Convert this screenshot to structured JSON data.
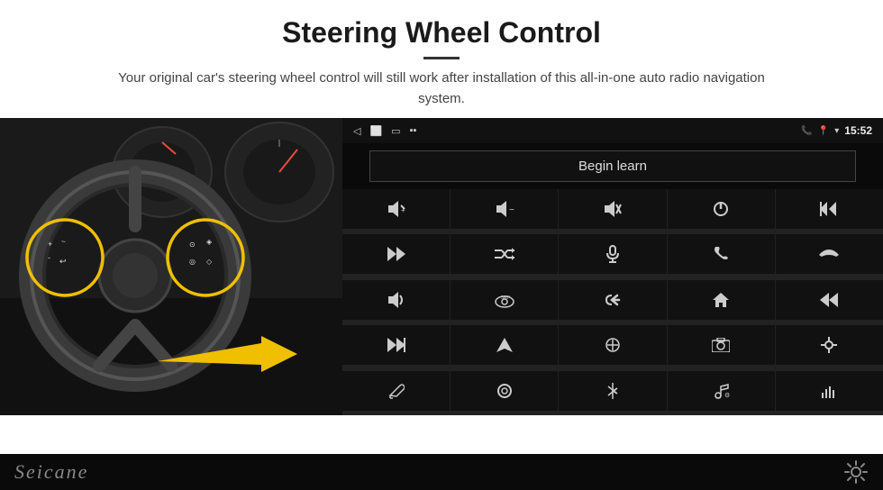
{
  "header": {
    "title": "Steering Wheel Control",
    "subtitle": "Your original car's steering wheel control will still work after installation of this all-in-one auto radio navigation system."
  },
  "android_screen": {
    "status_bar": {
      "time": "15:52",
      "icons": [
        "back",
        "home",
        "recent",
        "signal",
        "gps",
        "wifi",
        "battery"
      ]
    },
    "begin_learn_label": "Begin learn",
    "control_buttons": [
      {
        "icon": "vol+",
        "unicode": "🔊+"
      },
      {
        "icon": "vol-",
        "unicode": "🔉-"
      },
      {
        "icon": "mute",
        "unicode": "🔇"
      },
      {
        "icon": "power",
        "unicode": "⏻"
      },
      {
        "icon": "prev-track",
        "unicode": "⏮"
      },
      {
        "icon": "next",
        "unicode": "⏭"
      },
      {
        "icon": "shuffle",
        "unicode": "⇄"
      },
      {
        "icon": "mic",
        "unicode": "🎤"
      },
      {
        "icon": "phone",
        "unicode": "📞"
      },
      {
        "icon": "hang-up",
        "unicode": "📵"
      },
      {
        "icon": "horn",
        "unicode": "📣"
      },
      {
        "icon": "360",
        "unicode": "360°"
      },
      {
        "icon": "back-nav",
        "unicode": "↩"
      },
      {
        "icon": "home-nav",
        "unicode": "⌂"
      },
      {
        "icon": "skip-back",
        "unicode": "⏮"
      },
      {
        "icon": "fast-forward",
        "unicode": "⏭"
      },
      {
        "icon": "nav",
        "unicode": "➤"
      },
      {
        "icon": "equalizer",
        "unicode": "⇌"
      },
      {
        "icon": "camera",
        "unicode": "📷"
      },
      {
        "icon": "sliders",
        "unicode": "⚙"
      },
      {
        "icon": "pen",
        "unicode": "✏"
      },
      {
        "icon": "circle-btn",
        "unicode": "◎"
      },
      {
        "icon": "bluetooth",
        "unicode": "⚡"
      },
      {
        "icon": "music",
        "unicode": "♫"
      },
      {
        "icon": "spectrum",
        "unicode": "|||"
      }
    ]
  },
  "brand": {
    "name": "Seicane"
  }
}
